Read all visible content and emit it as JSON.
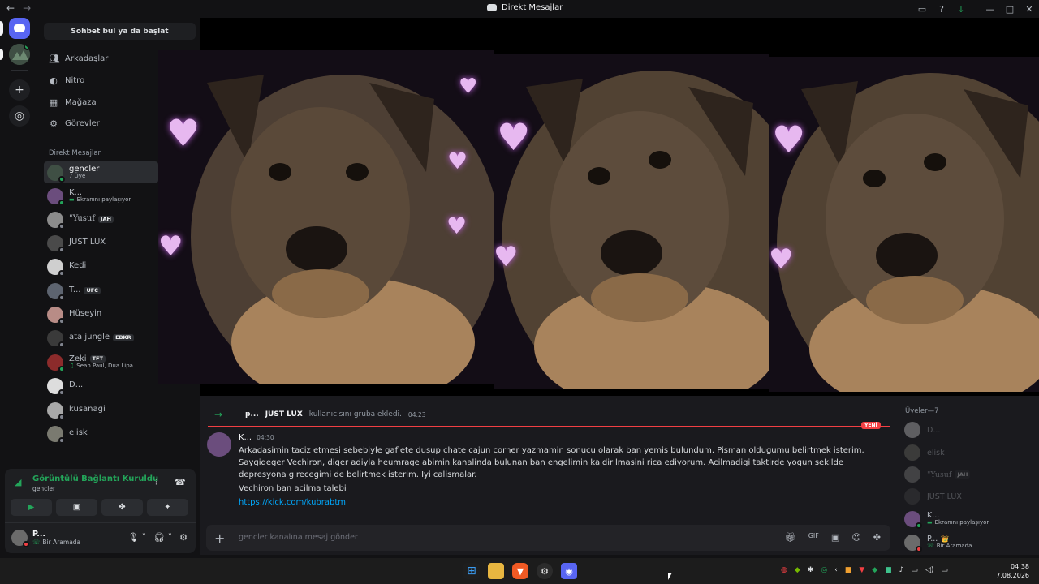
{
  "window": {
    "title": "Direkt Mesajlar",
    "nav_back": "←",
    "nav_forward": "→"
  },
  "sidebar": {
    "search_label": "Sohbet bul ya da başlat",
    "nav": [
      {
        "label": "Arkadaşlar",
        "icon": "friends-icon"
      },
      {
        "label": "Nitro",
        "icon": "nitro-icon"
      },
      {
        "label": "Mağaza",
        "icon": "shop-icon"
      },
      {
        "label": "Görevler",
        "icon": "quests-icon"
      }
    ],
    "dm_header": "Direkt Mesajlar",
    "dms": [
      {
        "name": "gencler",
        "sub": "7 Üye",
        "active": true
      },
      {
        "name": "K...",
        "sub": "Ekranını paylaşıyor"
      },
      {
        "name": "\"Yusuf",
        "badge": "JAH"
      },
      {
        "name": "JUST LUX"
      },
      {
        "name": "Kedi"
      },
      {
        "name": "T...",
        "badge": "UFC"
      },
      {
        "name": "Hüseyin"
      },
      {
        "name": "ata jungle",
        "badge": "EBKR"
      },
      {
        "name": "Zeki",
        "badge": "TFT",
        "sub": "Sean Paul, Dua Lipa"
      },
      {
        "name": "D..."
      },
      {
        "name": "kusanagi"
      },
      {
        "name": "elisk"
      }
    ]
  },
  "voice": {
    "status": "Görüntülü Bağlantı Kuruldu",
    "channel": "gencler",
    "user_name": "P...",
    "user_status": "Bir Aramada"
  },
  "chat": {
    "system_user": "p...",
    "system_target": "JUST LUX",
    "system_text": "kullanıcısını gruba ekledi.",
    "system_time": "04:23",
    "new_tag": "YENİ",
    "message": {
      "author": "K...",
      "time": "04:30",
      "line1": "Arkadasimin taciz etmesi sebebiyle gaflete dusup chate cajun corner yazmamin sonucu olarak ban yemis bulundum. Pisman oldugumu belirtmek isterim. Saygideger Vechiron, diger adiyla heumrage abimin kanalinda bulunan ban engelimin kaldirilmasini rica ediyorum. Acilmadigi taktirde yogun sekilde depresyona girecegimi de belirtmek isterim. Iyi calismalar.",
      "line2": "Vechiron ban acilma talebi",
      "link": "https://kick.com/kubrabtm"
    },
    "composer_placeholder": "gencler kanalına mesaj gönder"
  },
  "members": {
    "header": "Üyeler—7",
    "list": [
      {
        "name": "D...",
        "offline": true
      },
      {
        "name": "elisk",
        "offline": true
      },
      {
        "name": "\"Yusuf",
        "badge": "JAH",
        "offline": true
      },
      {
        "name": "JUST LUX",
        "offline": true
      },
      {
        "name": "K...",
        "sub": "Ekranını paylaşıyor"
      },
      {
        "name": "P...",
        "sub": "Bir Aramada",
        "crown": "👑"
      }
    ]
  },
  "taskbar": {
    "time": "04:38",
    "date": "7.08.2026"
  },
  "colors": {
    "accent": "#5865f2",
    "online": "#23a55a",
    "danger": "#f23f43",
    "link": "#00a8fc"
  }
}
